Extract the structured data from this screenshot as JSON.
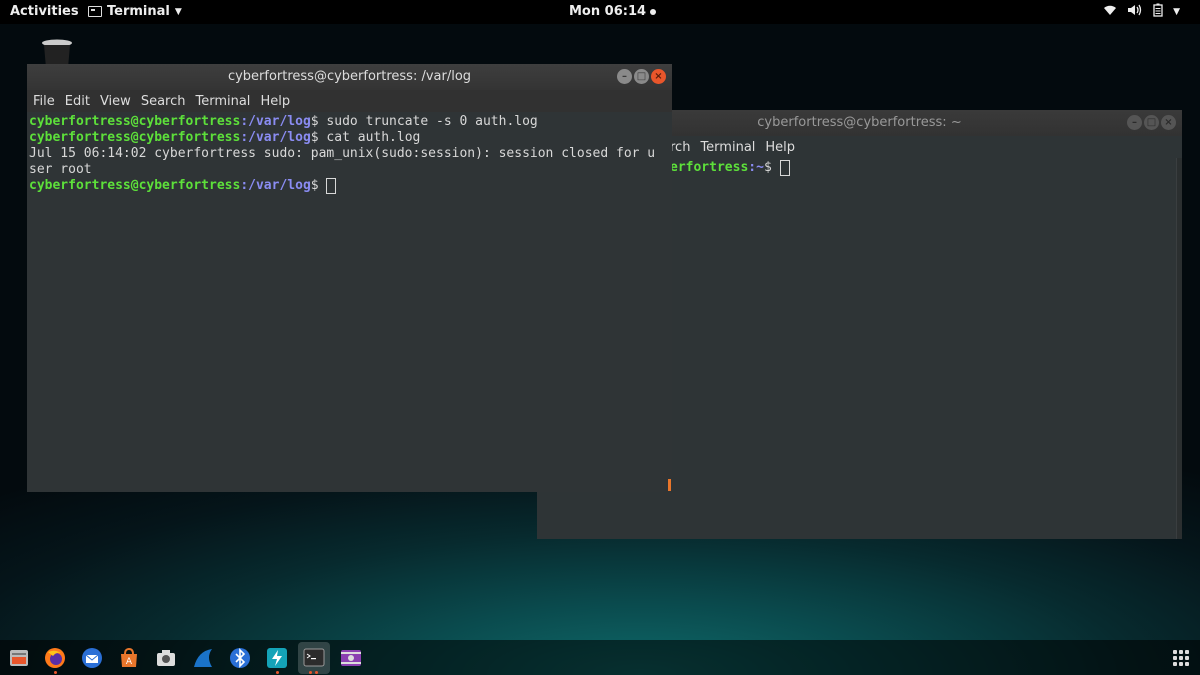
{
  "topbar": {
    "activities": "Activities",
    "app_name": "Terminal",
    "clock": "Mon 06:14"
  },
  "terminal_front": {
    "title": "cyberfortress@cyberfortress: /var/log",
    "menu": [
      "File",
      "Edit",
      "View",
      "Search",
      "Terminal",
      "Help"
    ],
    "lines": [
      {
        "user": "cyberfortress@cyberfortress",
        "path": ":/var/log",
        "cmd": "$ sudo truncate -s 0 auth.log"
      },
      {
        "user": "cyberfortress@cyberfortress",
        "path": ":/var/log",
        "cmd": "$ cat auth.log"
      },
      {
        "output": "Jul 15 06:14:02 cyberfortress sudo: pam_unix(sudo:session): session closed for u"
      },
      {
        "output": "ser root"
      },
      {
        "user": "cyberfortress@cyberfortress",
        "path": ":/var/log",
        "cmd": "$ "
      }
    ]
  },
  "terminal_back": {
    "title": "cyberfortress@cyberfortress: ~",
    "menu_visible": [
      "rch",
      "Terminal",
      "Help"
    ],
    "prompt_user": "erfortress",
    "prompt_path": ":~",
    "prompt_cmd": "$ "
  },
  "dock": {
    "items": [
      "files-icon",
      "firefox-icon",
      "thunderbird-icon",
      "software-icon",
      "screenshot-icon",
      "wireshark-icon",
      "bluetooth-icon",
      "app-icon",
      "terminal-icon",
      "video-icon"
    ]
  }
}
